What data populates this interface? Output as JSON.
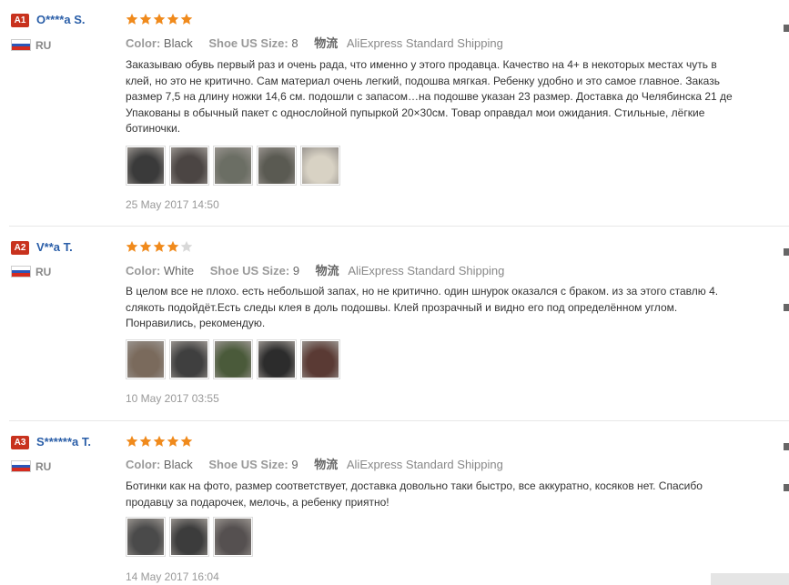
{
  "reviews": [
    {
      "badge": "A1",
      "user": "O****a S.",
      "country": "RU",
      "rating": 5,
      "color_label": "Color:",
      "color_value": "Black",
      "size_label": "Shoe US Size:",
      "size_value": "8",
      "ship_cn": "物流",
      "shipping": "AliExpress Standard Shipping",
      "text": "Заказываю обувь первый раз и очень рада, что именно у этого продавца. Качество на 4+ в некоторых местах чуть в\nклей, но это не критично. Сам материал очень легкий, подошва мягкая. Ребенку удобно и это самое главное. Заказь\nразмер 7,5 на длину ножки 14,6 см. подошли с запасом…на подошве указан 23 размер. Доставка до Челябинска 21 де\nУпакованы в обычный пакет с однослойной пупыркой 20×30см. Товар оправдал мои ожидания. Стильные, лёгкие\nботиночки.",
      "photos": [
        "#3a3a3a",
        "#4b4543",
        "#6b6e64",
        "#5a5a52",
        "#d8d2c4"
      ],
      "date": "25 May 2017 14:50"
    },
    {
      "badge": "A2",
      "user": "V**a T.",
      "country": "RU",
      "rating": 4,
      "color_label": "Color:",
      "color_value": "White",
      "size_label": "Shoe US Size:",
      "size_value": "9",
      "ship_cn": "物流",
      "shipping": "AliExpress Standard Shipping",
      "text": "В целом все не плохо. есть небольшой запах, но не критично. один шнурок оказался с браком. из за этого ставлю 4.\nслякоть подойдёт.Есть следы клея в доль подошвы. Клей прозрачный и видно его под определённом углом.\nПонравились, рекомендую.",
      "photos": [
        "#7a6a5c",
        "#3f3f3f",
        "#4a5a3a",
        "#2c2c2c",
        "#5a3a34"
      ],
      "date": "10 May 2017 03:55"
    },
    {
      "badge": "A3",
      "user": "S******a T.",
      "country": "RU",
      "rating": 5,
      "color_label": "Color:",
      "color_value": "Black",
      "size_label": "Shoe US Size:",
      "size_value": "9",
      "ship_cn": "物流",
      "shipping": "AliExpress Standard Shipping",
      "text": "Ботинки как на фото, размер соответствует, доставка довольно таки быстро, все аккуратно, косяков нет. Спасибо\nпродавцу за подарочек, мелочь, а ребенку приятно!",
      "photos": [
        "#4a4a4a",
        "#3c3c3c",
        "#555050"
      ],
      "date": "14 May 2017 16:04"
    }
  ],
  "colors": {
    "badge": "#c8321e",
    "username": "#2a5ea8",
    "star_filled": "#f08a1c",
    "star_empty": "#d8d8d8"
  }
}
